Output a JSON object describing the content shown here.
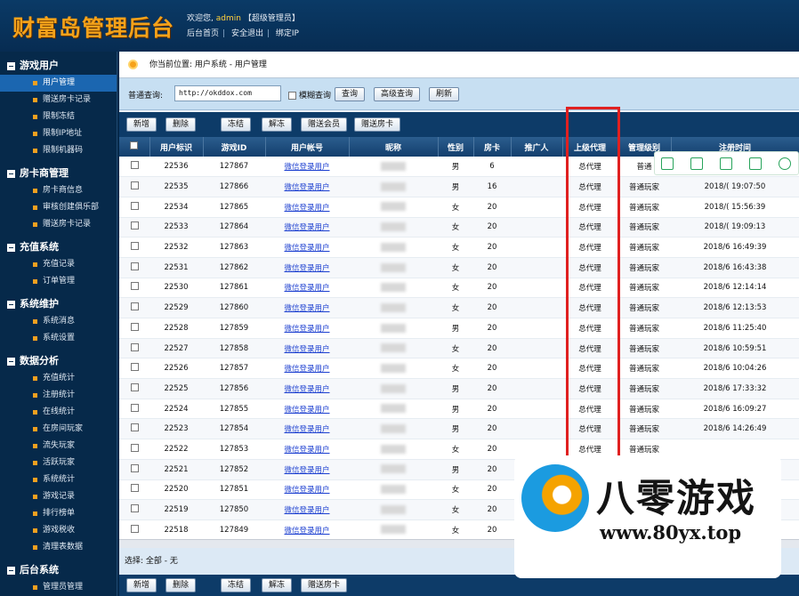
{
  "header": {
    "logo": "财富岛管理后台",
    "welcome_prefix": "欢迎您,",
    "username": "admin",
    "role": "【超级管理员】",
    "links": [
      "后台首页",
      "安全退出",
      "绑定IP"
    ]
  },
  "sidebar": {
    "groups": [
      {
        "title": "游戏用户",
        "items": [
          "用户管理",
          "赠送房卡记录",
          "限制冻结",
          "限制IP地址",
          "限制机器码"
        ]
      },
      {
        "title": "房卡商管理",
        "items": [
          "房卡商信息",
          "审核创建俱乐部",
          "赠送房卡记录"
        ]
      },
      {
        "title": "充值系统",
        "items": [
          "充值记录",
          "订单管理"
        ]
      },
      {
        "title": "系统维护",
        "items": [
          "系统消息",
          "系统设置"
        ]
      },
      {
        "title": "数据分析",
        "items": [
          "充值统计",
          "注册统计",
          "在线统计",
          "在房间玩家",
          "流失玩家",
          "活跃玩家",
          "系统统计",
          "游戏记录",
          "排行榜单",
          "游戏税收",
          "清理表数据"
        ]
      },
      {
        "title": "后台系统",
        "items": [
          "管理员管理",
          "安全日志"
        ]
      }
    ],
    "active_item": "用户管理"
  },
  "breadcrumb": "你当前位置: 用户系统 - 用户管理",
  "search": {
    "label": "普通查询:",
    "value": "http://okddox.com",
    "fuzzy_label": "模糊查询",
    "query_button": "查询",
    "advanced_button": "高级查询",
    "refresh_button": "刷新"
  },
  "toolbar_top": [
    "新增",
    "删除",
    "冻结",
    "解冻",
    "赠送会员",
    "赠送房卡"
  ],
  "toolbar_bottom": [
    "新增",
    "删除",
    "冻结",
    "解冻",
    "赠送房卡"
  ],
  "table": {
    "columns": [
      "用户标识",
      "游戏ID",
      "用户帐号",
      "昵称",
      "性别",
      "房卡",
      "推广人",
      "上级代理",
      "管理级别",
      "注册时间"
    ],
    "rows": [
      {
        "uid": "22536",
        "gid": "127867",
        "account": "微信登录用户",
        "gender": "男",
        "cards": "6",
        "agent": "总代理",
        "level": "普通",
        "time": ""
      },
      {
        "uid": "22535",
        "gid": "127866",
        "account": "微信登录用户",
        "gender": "男",
        "cards": "16",
        "agent": "总代理",
        "level": "普通玩家",
        "time": "2018/(   19:07:50"
      },
      {
        "uid": "22534",
        "gid": "127865",
        "account": "微信登录用户",
        "gender": "女",
        "cards": "20",
        "agent": "总代理",
        "level": "普通玩家",
        "time": "2018/(   15:56:39"
      },
      {
        "uid": "22533",
        "gid": "127864",
        "account": "微信登录用户",
        "gender": "女",
        "cards": "20",
        "agent": "总代理",
        "level": "普通玩家",
        "time": "2018/(   19:09:13"
      },
      {
        "uid": "22532",
        "gid": "127863",
        "account": "微信登录用户",
        "gender": "女",
        "cards": "20",
        "agent": "总代理",
        "level": "普通玩家",
        "time": "2018/6   16:49:39"
      },
      {
        "uid": "22531",
        "gid": "127862",
        "account": "微信登录用户",
        "gender": "女",
        "cards": "20",
        "agent": "总代理",
        "level": "普通玩家",
        "time": "2018/6   16:43:38"
      },
      {
        "uid": "22530",
        "gid": "127861",
        "account": "微信登录用户",
        "gender": "女",
        "cards": "20",
        "agent": "总代理",
        "level": "普通玩家",
        "time": "2018/6   12:14:14"
      },
      {
        "uid": "22529",
        "gid": "127860",
        "account": "微信登录用户",
        "gender": "女",
        "cards": "20",
        "agent": "总代理",
        "level": "普通玩家",
        "time": "2018/6   12:13:53"
      },
      {
        "uid": "22528",
        "gid": "127859",
        "account": "微信登录用户",
        "gender": "男",
        "cards": "20",
        "agent": "总代理",
        "level": "普通玩家",
        "time": "2018/6   11:25:40"
      },
      {
        "uid": "22527",
        "gid": "127858",
        "account": "微信登录用户",
        "gender": "女",
        "cards": "20",
        "agent": "总代理",
        "level": "普通玩家",
        "time": "2018/6   10:59:51"
      },
      {
        "uid": "22526",
        "gid": "127857",
        "account": "微信登录用户",
        "gender": "女",
        "cards": "20",
        "agent": "总代理",
        "level": "普通玩家",
        "time": "2018/6   10:04:26"
      },
      {
        "uid": "22525",
        "gid": "127856",
        "account": "微信登录用户",
        "gender": "男",
        "cards": "20",
        "agent": "总代理",
        "level": "普通玩家",
        "time": "2018/6   17:33:32"
      },
      {
        "uid": "22524",
        "gid": "127855",
        "account": "微信登录用户",
        "gender": "男",
        "cards": "20",
        "agent": "总代理",
        "level": "普通玩家",
        "time": "2018/6   16:09:27"
      },
      {
        "uid": "22523",
        "gid": "127854",
        "account": "微信登录用户",
        "gender": "男",
        "cards": "20",
        "agent": "总代理",
        "level": "普通玩家",
        "time": "2018/6   14:26:49"
      },
      {
        "uid": "22522",
        "gid": "127853",
        "account": "微信登录用户",
        "gender": "女",
        "cards": "20",
        "agent": "总代理",
        "level": "普通玩家",
        "time": ""
      },
      {
        "uid": "22521",
        "gid": "127852",
        "account": "微信登录用户",
        "gender": "男",
        "cards": "20",
        "agent": "",
        "level": "",
        "time": ""
      },
      {
        "uid": "22520",
        "gid": "127851",
        "account": "微信登录用户",
        "gender": "女",
        "cards": "20",
        "agent": "",
        "level": "",
        "time": ""
      },
      {
        "uid": "22519",
        "gid": "127850",
        "account": "微信登录用户",
        "gender": "女",
        "cards": "20",
        "agent": "",
        "level": "",
        "time": ""
      },
      {
        "uid": "22518",
        "gid": "127849",
        "account": "微信登录用户",
        "gender": "女",
        "cards": "20",
        "agent": "",
        "level": "",
        "time": ""
      }
    ]
  },
  "selection": "选择: 全部 - 无",
  "watermark": {
    "text": "八零游戏",
    "url": "www.80yx.top"
  },
  "colors": {
    "accent": "#0d3b68",
    "highlight": "#e02020",
    "logo": "#f4a21a"
  }
}
